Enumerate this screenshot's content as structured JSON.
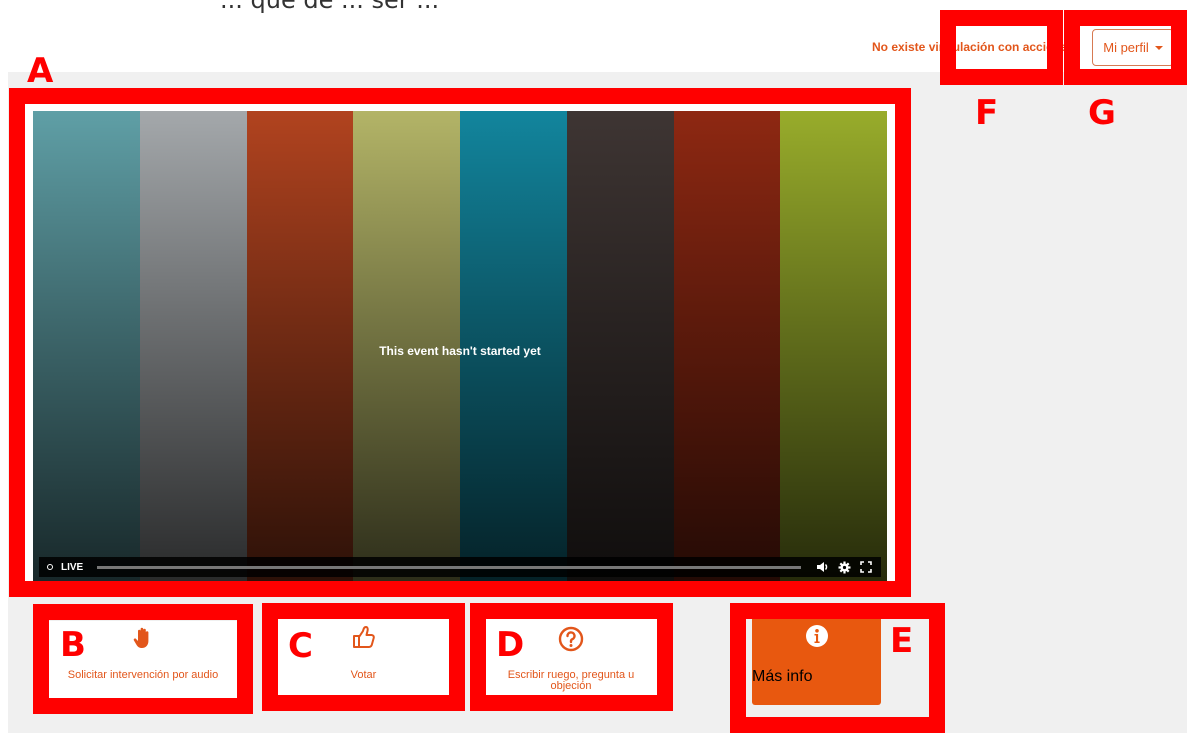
{
  "top_caption": "... que de ... ser ...",
  "header": {
    "status_text": "No existe vinculación con acciones",
    "profile_label": "Mi perfil"
  },
  "player": {
    "message": "This event hasn't started yet",
    "live_label": "LIVE",
    "bar_colors": [
      "#5f9fa6",
      "#a4a8ab",
      "#b1431f",
      "#b3b467",
      "#12859d",
      "#3e3533",
      "#8e2812",
      "#98ac2b"
    ]
  },
  "actions": [
    {
      "id": "audio",
      "label": "Solicitar intervención por audio",
      "icon": "raised-hand-icon"
    },
    {
      "id": "vote",
      "label": "Votar",
      "icon": "thumbs-up-icon"
    },
    {
      "id": "question",
      "label_line1": "Escribir ruego, pregunta u",
      "label_line2": "objeción",
      "icon": "question-circle-icon"
    },
    {
      "id": "info",
      "label": "Más info",
      "icon": "info-circle-icon"
    }
  ],
  "annotations": [
    "A",
    "B",
    "C",
    "D",
    "E",
    "F",
    "G"
  ],
  "colors": {
    "accent": "#e2561b",
    "annotation": "#ff0000",
    "background": "#f0f0f0"
  }
}
